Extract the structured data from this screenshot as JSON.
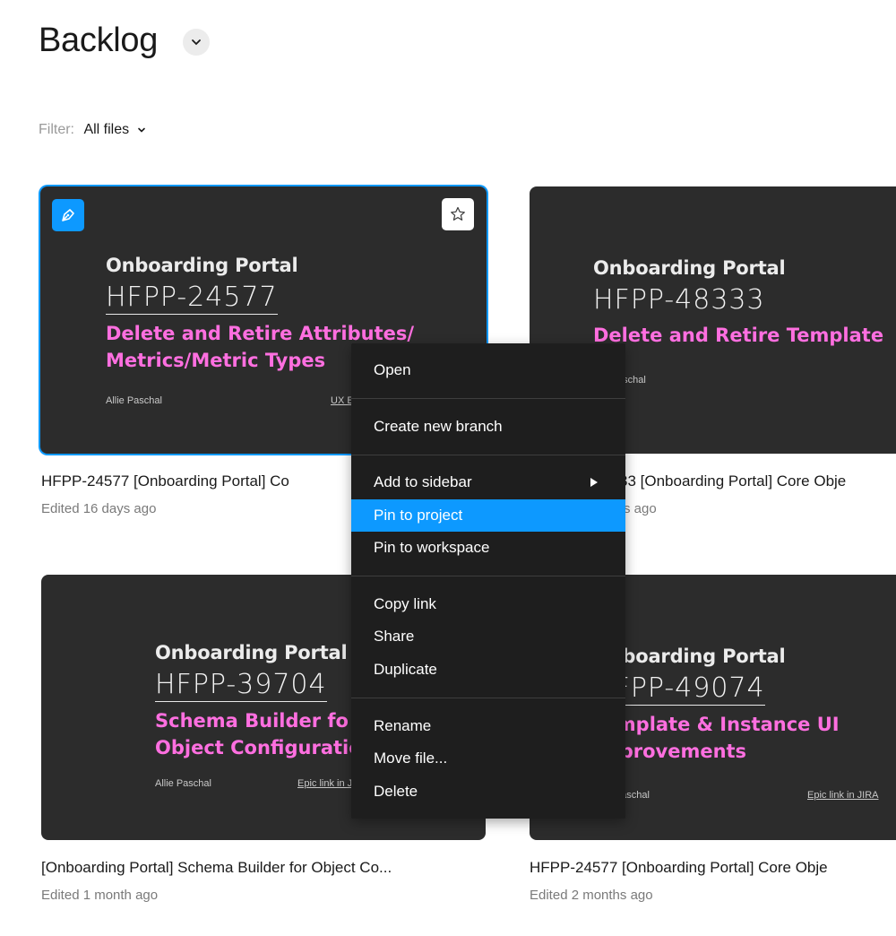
{
  "header": {
    "title": "Backlog",
    "filter_label": "Filter:",
    "filter_value": "All files"
  },
  "files": [
    {
      "project": "Onboarding Portal",
      "ticket": "HFPP-24577",
      "description_line1": "Delete and Retire Attributes/",
      "description_line2": "Metrics/Metric Types",
      "author": "Allie Paschal",
      "link": "UX E",
      "name": "HFPP-24577 [Onboarding Portal] Co",
      "edited": "Edited 16 days ago"
    },
    {
      "project": "Onboarding Portal",
      "ticket": "HFPP-48333",
      "description_line1": "Delete and Retire Template",
      "author": "aschal",
      "name": "33 [Onboarding Portal] Core Obje",
      "edited": "s ago"
    },
    {
      "project": "Onboarding Portal",
      "ticket": "HFPP-39704",
      "description_line1": "Schema Builder  fo",
      "description_line2": "Object Configuratio",
      "author": "Allie Paschal",
      "link": "Epic link in J",
      "name": "[Onboarding Portal] Schema Builder for Object Co...",
      "edited": "Edited 1 month ago"
    },
    {
      "project": "Onboarding Portal",
      "ticket": "HFPP-49074",
      "description_line1": "Template & Instance UI",
      "description_line2": "Improvements",
      "author": "Allie Paschal",
      "link": "Epic link in JIRA",
      "name": "HFPP-24577 [Onboarding Portal] Core Obje",
      "edited": "Edited 2 months ago"
    }
  ],
  "context_menu": {
    "open": "Open",
    "create_branch": "Create new branch",
    "add_to_sidebar": "Add to sidebar",
    "pin_to_project": "Pin to project",
    "pin_to_workspace": "Pin to workspace",
    "copy_link": "Copy link",
    "share": "Share",
    "duplicate": "Duplicate",
    "rename": "Rename",
    "move_file": "Move file...",
    "delete": "Delete",
    "highlighted_item": "Pin to project"
  },
  "colors": {
    "accent": "#0d99ff",
    "card_bg": "#2c2c2c",
    "description_pink": "#ff6fe0",
    "menu_bg": "#1e1e1e"
  },
  "icons": {
    "title_dropdown": "chevron-down-icon",
    "filter_dropdown": "chevron-down-icon",
    "file_type": "pen-tool-icon",
    "favorite": "star-icon",
    "submenu": "triangle-right-icon"
  }
}
